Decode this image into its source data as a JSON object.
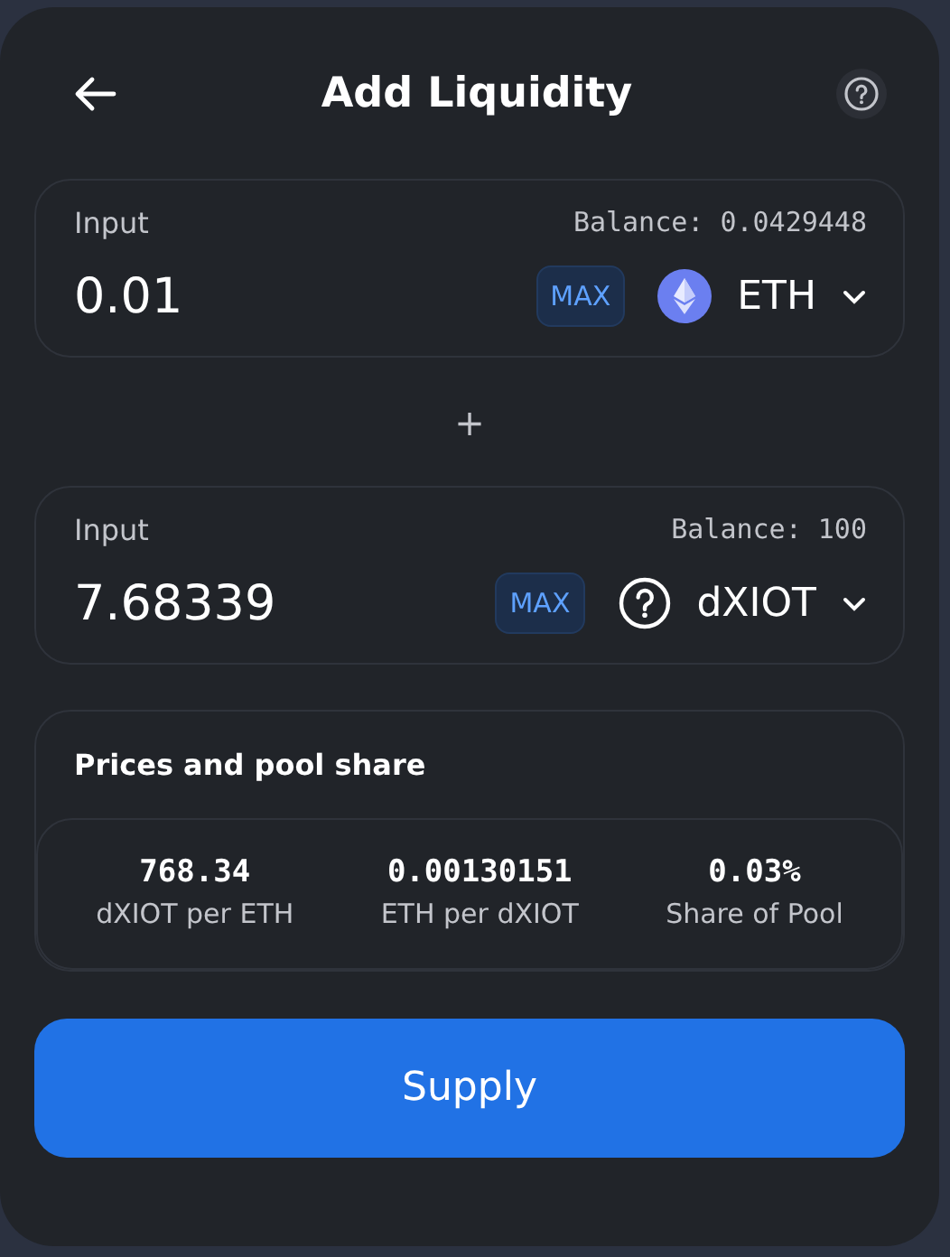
{
  "header": {
    "title": "Add Liquidity"
  },
  "inputs": [
    {
      "label": "Input",
      "balance": "Balance: 0.0429448",
      "value": "0.01",
      "max": "MAX",
      "token": {
        "symbol": "ETH",
        "kind": "eth"
      }
    },
    {
      "label": "Input",
      "balance": "Balance: 100",
      "value": "7.68339",
      "max": "MAX",
      "token": {
        "symbol": "dXIOT",
        "kind": "unknown"
      }
    }
  ],
  "separator": "+",
  "prices": {
    "title": "Prices and pool share",
    "stats": [
      {
        "value": "768.34",
        "label": "dXIOT per ETH"
      },
      {
        "value": "0.00130151",
        "label": "ETH per dXIOT"
      },
      {
        "value": "0.03%",
        "label": "Share of Pool"
      }
    ]
  },
  "supply_button": "Supply"
}
